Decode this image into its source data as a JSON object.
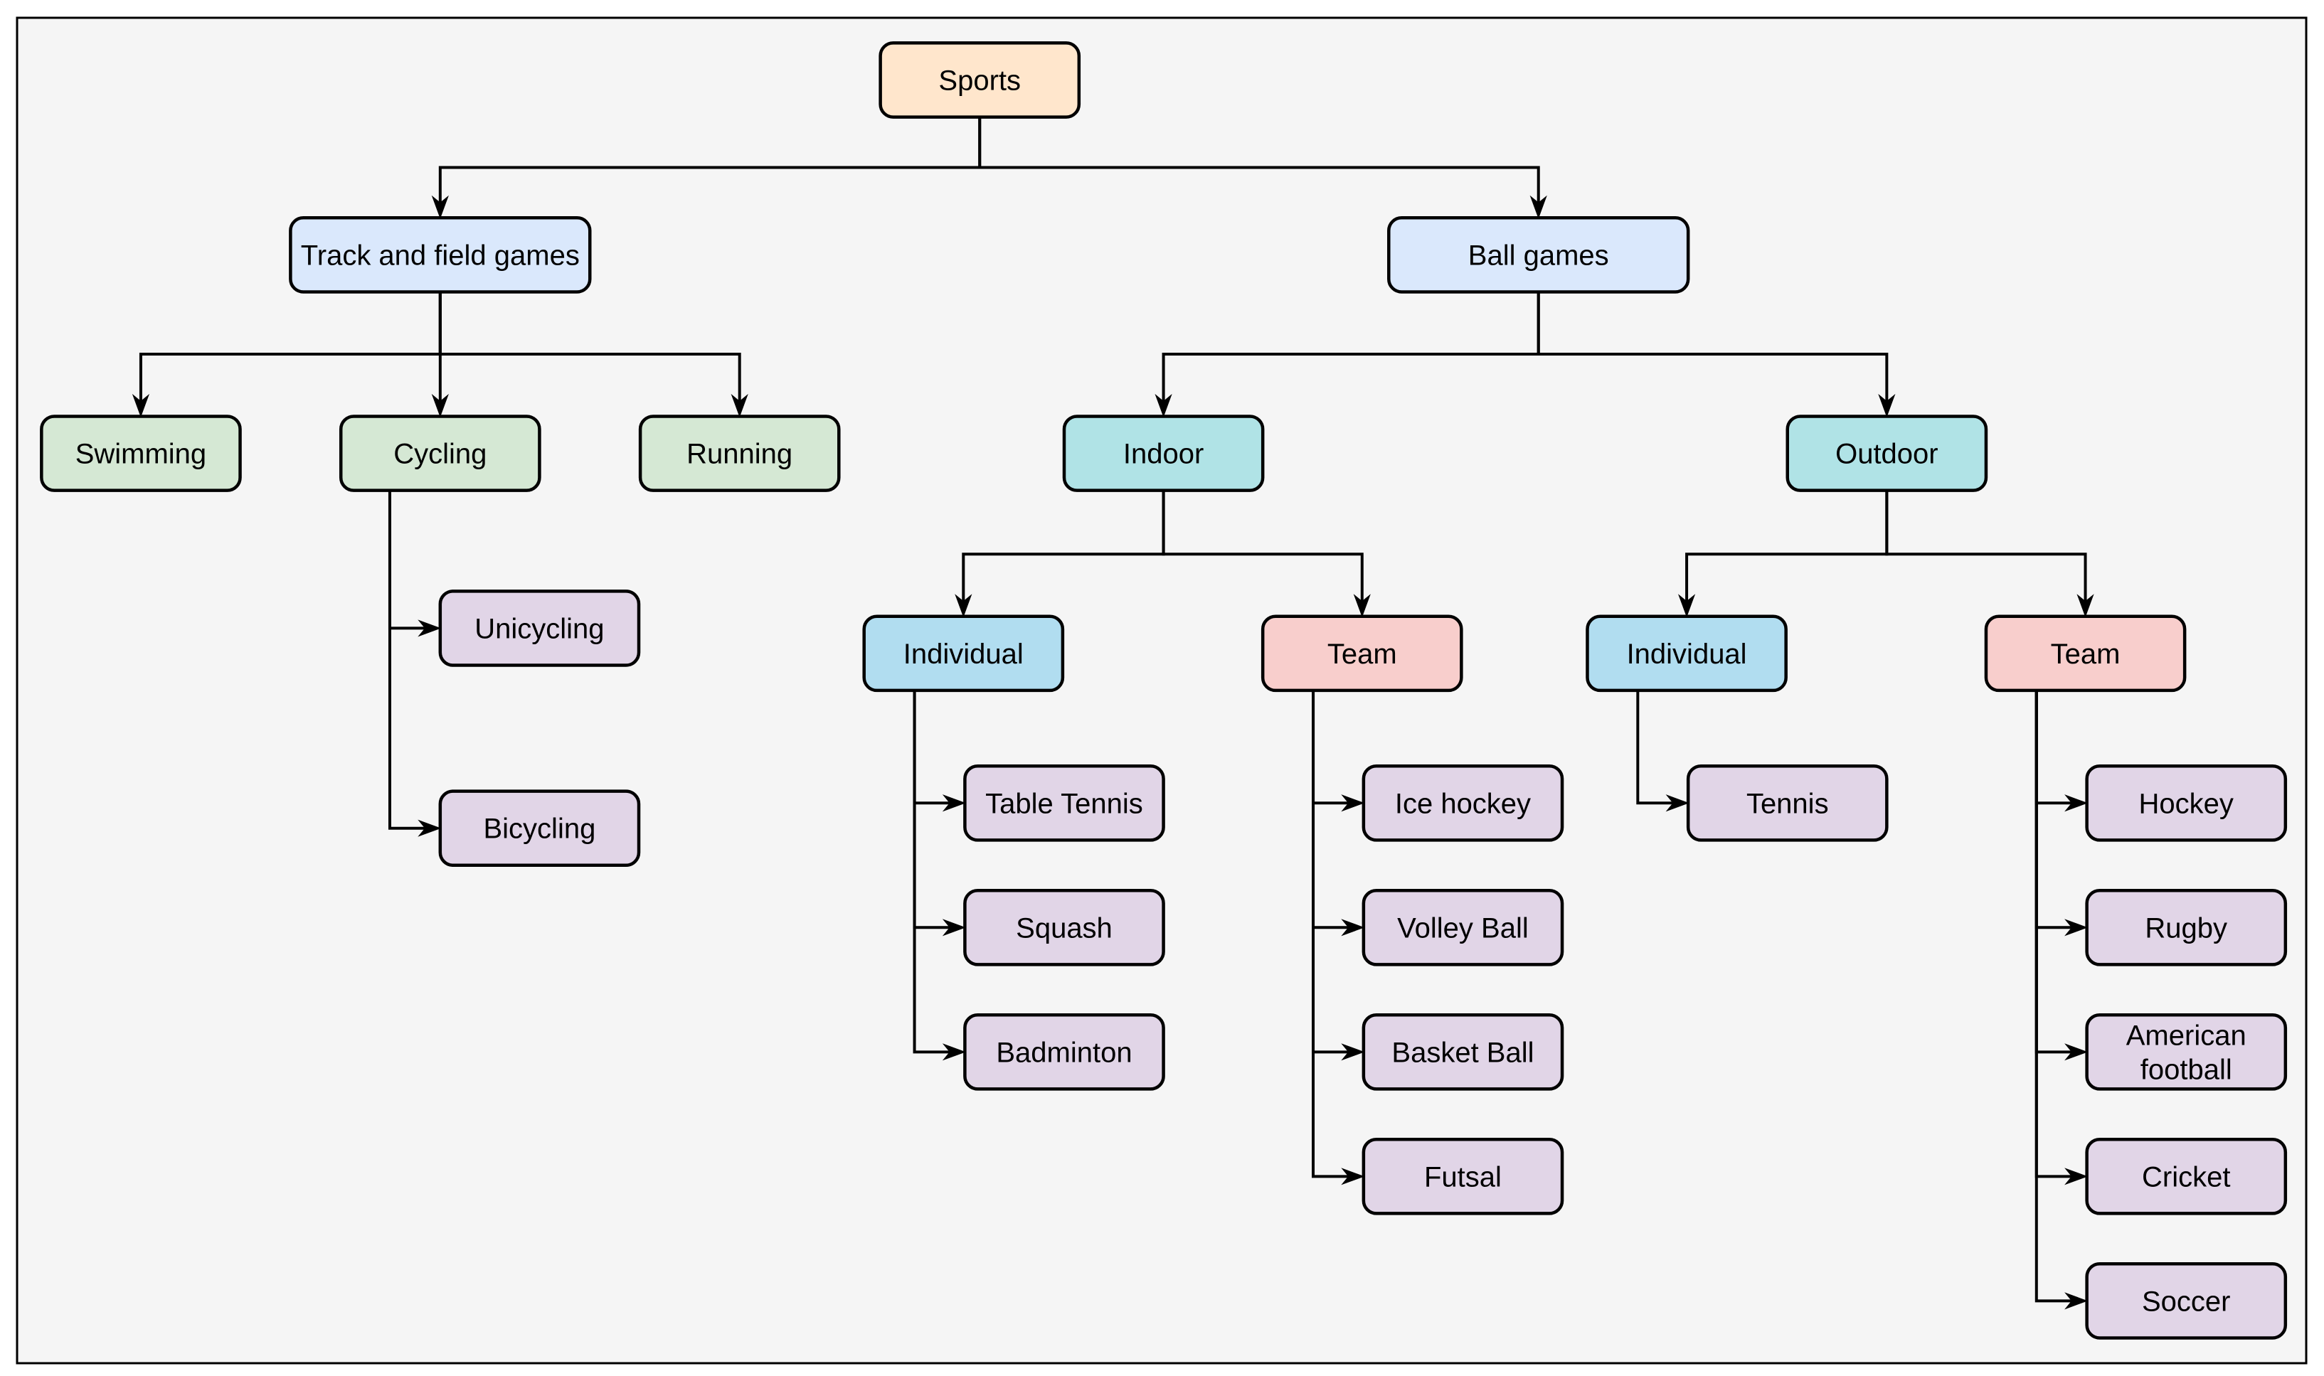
{
  "diagram": {
    "type": "tree",
    "background_color": "#f5f5f5",
    "colors": {
      "root": "#ffe6cc",
      "category": "#dae8fc",
      "track_item": "#d5e8d4",
      "setting": "#b0e3e6",
      "individual": "#b1ddf0",
      "team": "#f8cecc",
      "leaf": "#e1d5e7"
    },
    "nodes": [
      {
        "id": "sports",
        "label": "Sports",
        "style": "root",
        "parent": null
      },
      {
        "id": "track",
        "label": "Track and field games",
        "style": "category",
        "parent": "sports"
      },
      {
        "id": "ball",
        "label": "Ball games",
        "style": "category",
        "parent": "sports"
      },
      {
        "id": "swimming",
        "label": "Swimming",
        "style": "track_item",
        "parent": "track"
      },
      {
        "id": "cycling",
        "label": "Cycling",
        "style": "track_item",
        "parent": "track"
      },
      {
        "id": "running",
        "label": "Running",
        "style": "track_item",
        "parent": "track"
      },
      {
        "id": "unicycling",
        "label": "Unicycling",
        "style": "leaf",
        "parent": "cycling"
      },
      {
        "id": "bicycling",
        "label": "Bicycling",
        "style": "leaf",
        "parent": "cycling"
      },
      {
        "id": "indoor",
        "label": "Indoor",
        "style": "setting",
        "parent": "ball"
      },
      {
        "id": "outdoor",
        "label": "Outdoor",
        "style": "setting",
        "parent": "ball"
      },
      {
        "id": "indoor_individual",
        "label": "Individual",
        "style": "individual",
        "parent": "indoor"
      },
      {
        "id": "indoor_team",
        "label": "Team",
        "style": "team",
        "parent": "indoor"
      },
      {
        "id": "outdoor_individual",
        "label": "Individual",
        "style": "individual",
        "parent": "outdoor"
      },
      {
        "id": "outdoor_team",
        "label": "Team",
        "style": "team",
        "parent": "outdoor"
      },
      {
        "id": "table_tennis",
        "label": "Table Tennis",
        "style": "leaf",
        "parent": "indoor_individual"
      },
      {
        "id": "squash",
        "label": "Squash",
        "style": "leaf",
        "parent": "indoor_individual"
      },
      {
        "id": "badminton",
        "label": "Badminton",
        "style": "leaf",
        "parent": "indoor_individual"
      },
      {
        "id": "ice_hockey",
        "label": "Ice hockey",
        "style": "leaf",
        "parent": "indoor_team"
      },
      {
        "id": "volley_ball",
        "label": "Volley Ball",
        "style": "leaf",
        "parent": "indoor_team"
      },
      {
        "id": "basket_ball",
        "label": "Basket Ball",
        "style": "leaf",
        "parent": "indoor_team"
      },
      {
        "id": "futsal",
        "label": "Futsal",
        "style": "leaf",
        "parent": "indoor_team"
      },
      {
        "id": "tennis",
        "label": "Tennis",
        "style": "leaf",
        "parent": "outdoor_individual"
      },
      {
        "id": "hockey",
        "label": "Hockey",
        "style": "leaf",
        "parent": "outdoor_team"
      },
      {
        "id": "rugby",
        "label": "Rugby",
        "style": "leaf",
        "parent": "outdoor_team"
      },
      {
        "id": "american_football",
        "label": "American football",
        "label_lines": [
          "American",
          "football"
        ],
        "style": "leaf",
        "parent": "outdoor_team"
      },
      {
        "id": "cricket",
        "label": "Cricket",
        "style": "leaf",
        "parent": "outdoor_team"
      },
      {
        "id": "soccer",
        "label": "Soccer",
        "style": "leaf",
        "parent": "outdoor_team"
      }
    ]
  }
}
